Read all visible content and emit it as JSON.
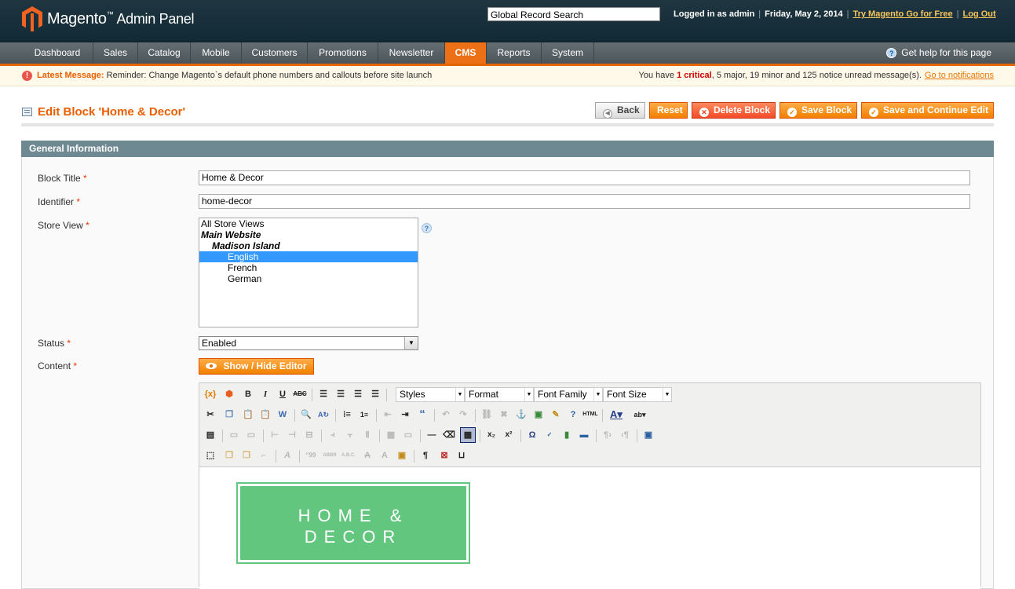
{
  "header": {
    "brand": "Magento",
    "brand_tm": "™",
    "subtitle": "Admin Panel",
    "search_value": "Global Record Search",
    "logged_in": "Logged in as admin",
    "date": "Friday, May 2, 2014",
    "try_link": "Try Magento Go for Free",
    "logout": "Log Out"
  },
  "nav": {
    "items": [
      "Dashboard",
      "Sales",
      "Catalog",
      "Mobile",
      "Customers",
      "Promotions",
      "Newsletter",
      "CMS",
      "Reports",
      "System"
    ],
    "active": "CMS",
    "help": "Get help for this page"
  },
  "message": {
    "label": "Latest Message:",
    "text": "Reminder: Change Magento`s default phone numbers and callouts before site launch",
    "summary_prefix": "You have",
    "critical": "1 critical",
    "summary_rest": ", 5 major, 19 minor and 125 notice unread message(s).",
    "link": "Go to notifications"
  },
  "page": {
    "title": "Edit Block 'Home & Decor'",
    "buttons": {
      "back": "Back",
      "reset": "Reset",
      "delete": "Delete Block",
      "save": "Save Block",
      "save_continue": "Save and Continue Edit"
    }
  },
  "form": {
    "section_title": "General Information",
    "block_title_label": "Block Title",
    "block_title_value": "Home & Decor",
    "identifier_label": "Identifier",
    "identifier_value": "home-decor",
    "store_view_label": "Store View",
    "store_view_options": [
      {
        "text": "All Store Views",
        "type": "option",
        "level": 0,
        "selected": false
      },
      {
        "text": "Main Website",
        "type": "group",
        "level": 0,
        "selected": false
      },
      {
        "text": "Madison Island",
        "type": "group",
        "level": 1,
        "selected": false
      },
      {
        "text": "English",
        "type": "option",
        "level": 2,
        "selected": true
      },
      {
        "text": "French",
        "type": "option",
        "level": 2,
        "selected": false
      },
      {
        "text": "German",
        "type": "option",
        "level": 2,
        "selected": false
      }
    ],
    "status_label": "Status",
    "status_value": "Enabled",
    "content_label": "Content",
    "required_mark": "*",
    "show_hide_editor": "Show / Hide Editor"
  },
  "editor": {
    "dropdowns": {
      "styles": "Styles",
      "format": "Format",
      "font_family": "Font Family",
      "font_size": "Font Size"
    },
    "content_banner_line1": "HOME &",
    "content_banner_line2": "DECOR",
    "banner_color": "#62c67f"
  },
  "colors": {
    "accent": "#eb5e00",
    "header_bg": "#1a313c",
    "nav_bg": "#5a6367",
    "section_header": "#6f8992"
  }
}
